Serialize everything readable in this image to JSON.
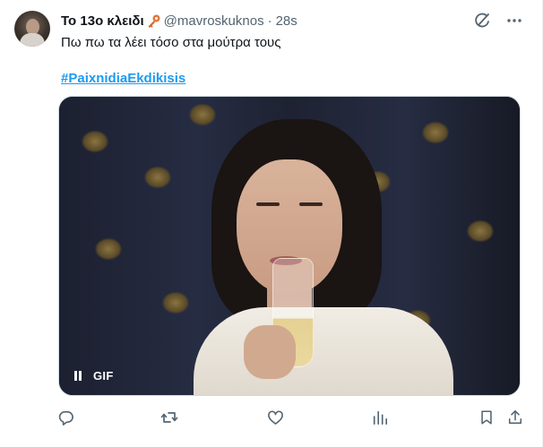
{
  "tweet": {
    "author_name": "Το 13ο κλειδι",
    "author_handle": "@mavroskuknos",
    "separator": "·",
    "timestamp": "28s",
    "text": "Πω πω τα λέει τόσο στα μούτρα τους",
    "hashtag": "#PaixnidiaEkdikisis"
  },
  "media": {
    "gif_label": "GIF"
  },
  "icons": {
    "author_badge": "key-icon",
    "top_right": [
      "grok-icon",
      "more-icon"
    ],
    "media_controls": [
      "pause-icon"
    ],
    "actions": [
      "reply-icon",
      "retweet-icon",
      "like-icon",
      "views-icon",
      "bookmark-icon",
      "share-icon"
    ]
  },
  "colors": {
    "accent": "#1d9bf0",
    "text_primary": "#0f1419",
    "text_secondary": "#536471"
  }
}
